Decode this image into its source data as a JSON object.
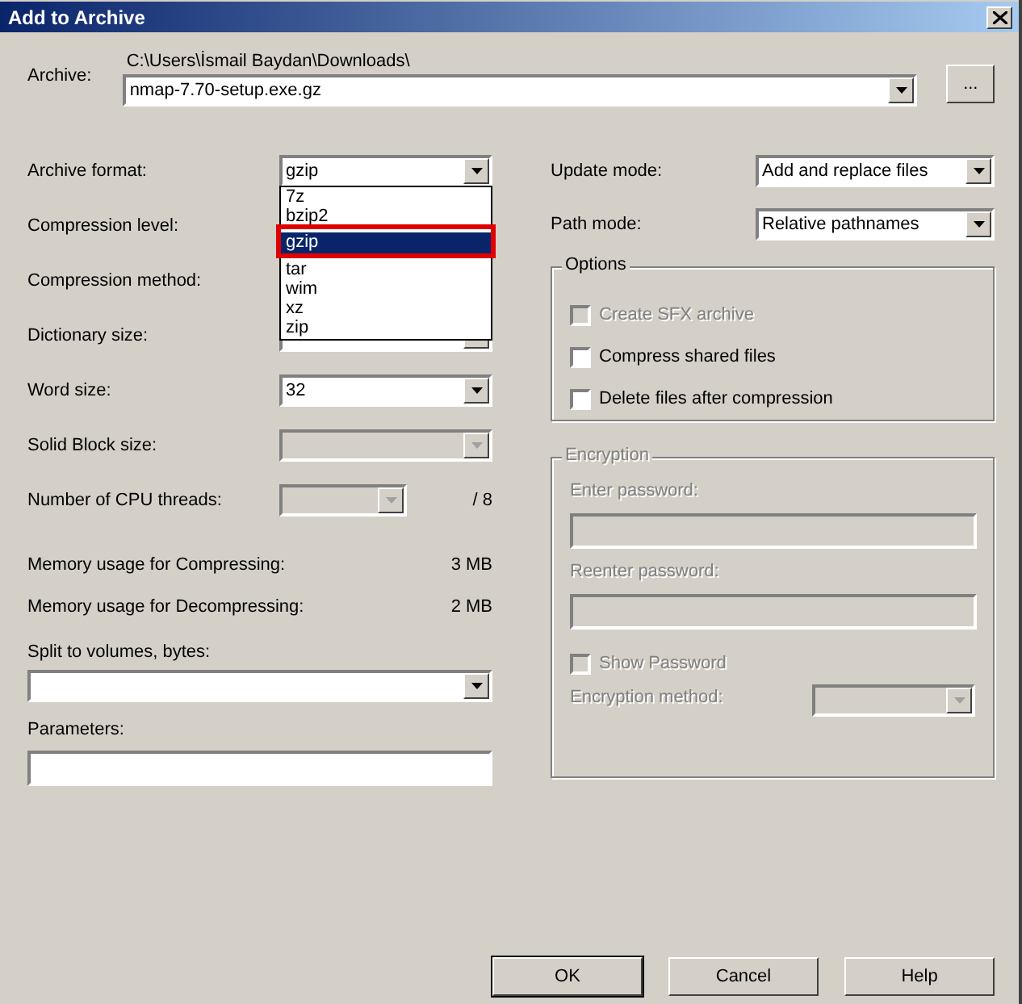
{
  "window": {
    "title": "Add to Archive"
  },
  "archive": {
    "label": "Archive:",
    "path": "C:\\Users\\İsmail Baydan\\Downloads\\",
    "value": "nmap-7.70-setup.exe.gz",
    "browse": "..."
  },
  "left_rows": [
    {
      "kind": "combo",
      "label": "Archive format:",
      "value": "gzip",
      "disabled": false
    },
    {
      "kind": "covered",
      "label": "Compression level:"
    },
    {
      "kind": "covered",
      "label": "Compression method:"
    },
    {
      "kind": "combo",
      "label": "Dictionary size:",
      "value": "",
      "disabled": false
    },
    {
      "kind": "combo",
      "label": "Word size:",
      "value": "32",
      "disabled": false
    },
    {
      "kind": "combo",
      "label": "Solid Block size:",
      "value": "",
      "disabled": true
    },
    {
      "kind": "threads",
      "label": "Number of CPU threads:",
      "value": "",
      "disabled": true,
      "suffix": "/ 8"
    },
    {
      "kind": "info",
      "label": "Memory usage for Compressing:",
      "value": "3 MB"
    },
    {
      "kind": "info",
      "label": "Memory usage for Decompressing:",
      "value": "2 MB"
    }
  ],
  "format_list": [
    {
      "label": "7z",
      "selected": false
    },
    {
      "label": "bzip2",
      "selected": false
    },
    {
      "label": "gzip",
      "selected": true
    },
    {
      "label": "tar",
      "selected": false
    },
    {
      "label": "wim",
      "selected": false
    },
    {
      "label": "xz",
      "selected": false
    },
    {
      "label": "zip",
      "selected": false
    }
  ],
  "split": {
    "label": "Split to volumes, bytes:"
  },
  "parameters": {
    "label": "Parameters:"
  },
  "right_rows": [
    {
      "label": "Update mode:",
      "value": "Add and replace files"
    },
    {
      "label": "Path mode:",
      "value": "Relative pathnames"
    }
  ],
  "options": {
    "title": "Options",
    "items": [
      {
        "label": "Create SFX archive",
        "checked": false,
        "disabled": true
      },
      {
        "label": "Compress shared files",
        "checked": false,
        "disabled": false
      },
      {
        "label": "Delete files after compression",
        "checked": false,
        "disabled": false
      }
    ]
  },
  "encryption": {
    "title": "Encryption",
    "disabled": true,
    "password_label": "Enter password:",
    "reenter_label": "Reenter password:",
    "show_password": {
      "label": "Show Password",
      "checked": false
    },
    "method_label": "Encryption method:"
  },
  "buttons": [
    {
      "label": "OK",
      "default": true
    },
    {
      "label": "Cancel",
      "default": false
    },
    {
      "label": "Help",
      "default": false
    }
  ]
}
